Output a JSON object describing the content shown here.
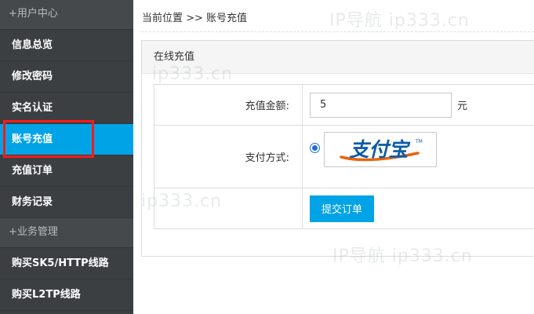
{
  "sidebar": {
    "sections": [
      {
        "label": "+用户中心",
        "items": [
          "信息总览",
          "修改密码",
          "实名认证",
          "账号充值",
          "充值订单",
          "财务记录"
        ]
      },
      {
        "label": "+业务管理",
        "items": [
          "购买SK5/HTTP线路",
          "购买L2TP线路"
        ]
      }
    ],
    "active_item": "账号充值"
  },
  "breadcrumb": "当前位置 >> 账号充值",
  "panel": {
    "title": "在线充值",
    "amount_label": "充值金额:",
    "amount_value": "5",
    "amount_unit": "元",
    "payment_label": "支付方式:",
    "payment_method": "支付宝",
    "submit_label": "提交订单"
  },
  "watermarks": [
    "IP导航 ip333.cn",
    "ip333.cn",
    "ip333.cn",
    "IP导航 ip333.cn"
  ],
  "colors": {
    "accent": "#00a3e6",
    "sidebar_bg": "#3b3f42",
    "highlight": "#ff1a1a",
    "alipay_orange": "#e8640c",
    "alipay_blue": "#0b5aa8"
  }
}
